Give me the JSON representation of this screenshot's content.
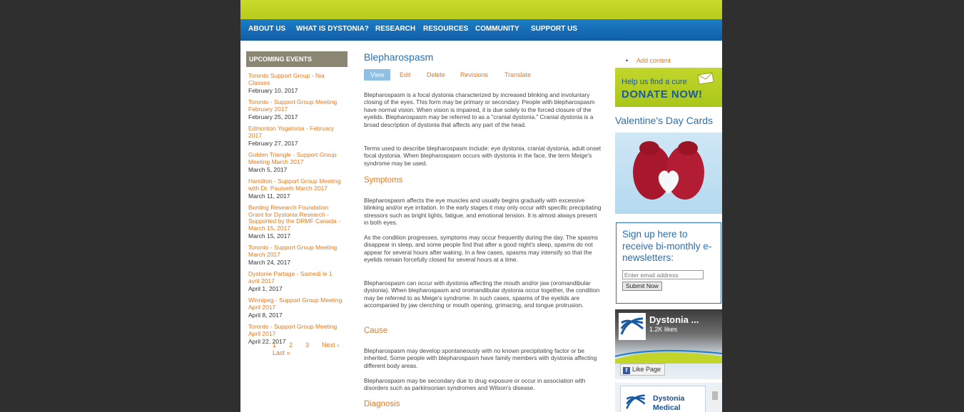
{
  "nav": {
    "items": [
      "ABOUT US",
      "WHAT IS DYSTONIA?",
      "RESEARCH",
      "RESOURCES",
      "COMMUNITY",
      "SUPPORT US"
    ]
  },
  "sidebar": {
    "events_header": "UPCOMING EVENTS",
    "events": [
      {
        "title": "Toronto Support Group - Nia Classes",
        "date": "February 10, 2017"
      },
      {
        "title": "Toronto - Support Group Meeting February 2017",
        "date": "February 25, 2017"
      },
      {
        "title": "Edmonton Yogatonia - February 2017",
        "date": "February 27, 2017"
      },
      {
        "title": "Golden Triangle - Support Group Meeting March 2017",
        "date": "March 5, 2017"
      },
      {
        "title": "Hamilton - Support Group Meeting with Dr. Pauiseth March 2017",
        "date": "March 11, 2017"
      },
      {
        "title": "Banting Research Foundation Grant for Dystonia Research - Supported by the DRMF Canada - March 15, 2017",
        "date": "March 15, 2017"
      },
      {
        "title": "Toronto - Support Group Meeting March 2017",
        "date": "March 24, 2017"
      },
      {
        "title": "Dystonie Partage - Samedi le 1 avril 2017",
        "date": "April 1, 2017"
      },
      {
        "title": "Winnipeg - Support Group Meeting April 2017",
        "date": "April 8, 2017"
      },
      {
        "title": "Toronto - Support Group Meeting April 2017",
        "date": "April 22, 2017"
      }
    ],
    "pager": {
      "p1": "1",
      "p2": "2",
      "p3": "3",
      "next": "Next ›",
      "last": "Last »"
    }
  },
  "main": {
    "title": "Blepharospasm",
    "tabs": [
      "View",
      "Edit",
      "Delete",
      "Revisions",
      "Translate"
    ],
    "p1": "Blepharospasm is a focal dystonia characterized by increased blinking and involuntary closing of the eyes. This form may be primary or secondary. People with blepharospasm have normal vision. When vision is impaired, it is due solely to the forced closure of the eyelids. Blepharospasm may be referred to as a \"cranial dystonia.\" Cranial dystonia is a broad description of dystonia that affects any part of the head.",
    "p2": "Terms used to describe blepharospasm include: eye dystonia, cranial dystonia, adult onset focal dystonia. When blepharospasm occurs with dystonia in the face, the term Meige's syndrome may be used.",
    "h_symptoms": "Symptoms",
    "p3": "Blepharospasm affects the eye muscles and usually begins gradually with excessive blinking and/or eye irritation. In the early stages it may only occur with specific precipitating stressors such as bright lights, fatigue, and emotional tension. It is almost always present in both eyes.",
    "p4": "As the condition progresses, symptoms may occur frequently during the day. The spasms disappear in sleep, and some people find that after a good night's sleep, spasms do not appear for several hours after waking. In a few cases, spasms may intensify so that the eyelids remain forcefully closed for several hours at a time.",
    "p5": "Blepharospasm can occur with dystonia affecting the mouth and/or jaw (oromandibular dystonia). When blepharospasm and oromandibular dystonia occur together, the condition may be referred to as Meige's syndrome. In such cases, spasms of the eyelids are accompanied by jaw clenching or mouth opening, grimacing, and tongue protrusion.",
    "h_cause": "Cause",
    "p6": "Blepharospasm may develop spontaneously with no known precipitating factor or be inherited. Some people with blepharospasm have family members with dystonia affecting different body areas.",
    "p7": "Blepharospasm may be secondary due to drug exposure or occur in association with disorders such as parkinsonian syndromes and Wilson's disease.",
    "h_diagnosis": "Diagnosis"
  },
  "right": {
    "add_content": "Add content",
    "donate_line1": "Help us find a cure",
    "donate_line2": "DONATE  NOW!",
    "valentine_title": "Valentine's Day Cards",
    "signup_text": "Sign up here to receive bi-monthly e-newsletters:",
    "email_placeholder": "Enter email address",
    "submit_label": "Submit Now",
    "fb_name": "Dystonia ...",
    "fb_likes": "1.2K likes",
    "fb_like_label": "Like Page",
    "dmrf_name": "Dystonia Medical"
  },
  "colors": {
    "accent_orange": "#e8781c",
    "nav_blue": "#1d7dc4",
    "lime": "#c2d62a",
    "heading_blue": "#2a6fb3"
  }
}
